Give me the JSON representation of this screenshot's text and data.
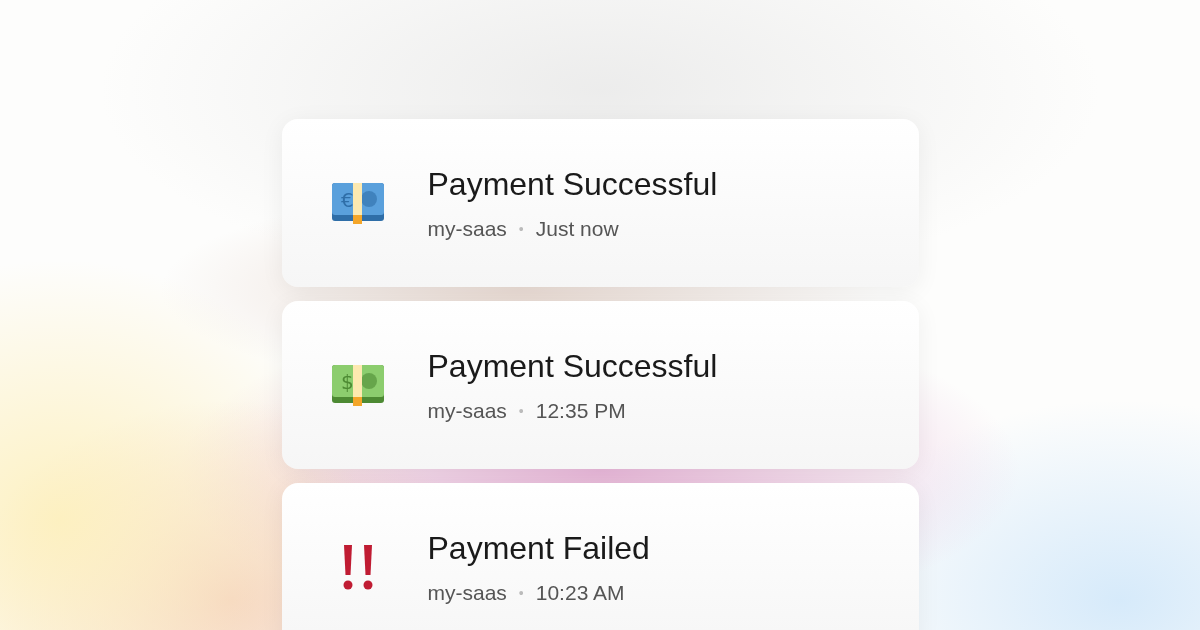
{
  "notifications": [
    {
      "kind": "euro-note",
      "symbol": "€",
      "title": "Payment Successful",
      "source": "my-saas",
      "separator": "•",
      "time": "Just now"
    },
    {
      "kind": "dollar-note",
      "symbol": "$",
      "title": "Payment Successful",
      "source": "my-saas",
      "separator": "•",
      "time": "12:35 PM"
    },
    {
      "kind": "alert",
      "title": "Payment Failed",
      "source": "my-saas",
      "separator": "•",
      "time": "10:23 AM"
    }
  ]
}
